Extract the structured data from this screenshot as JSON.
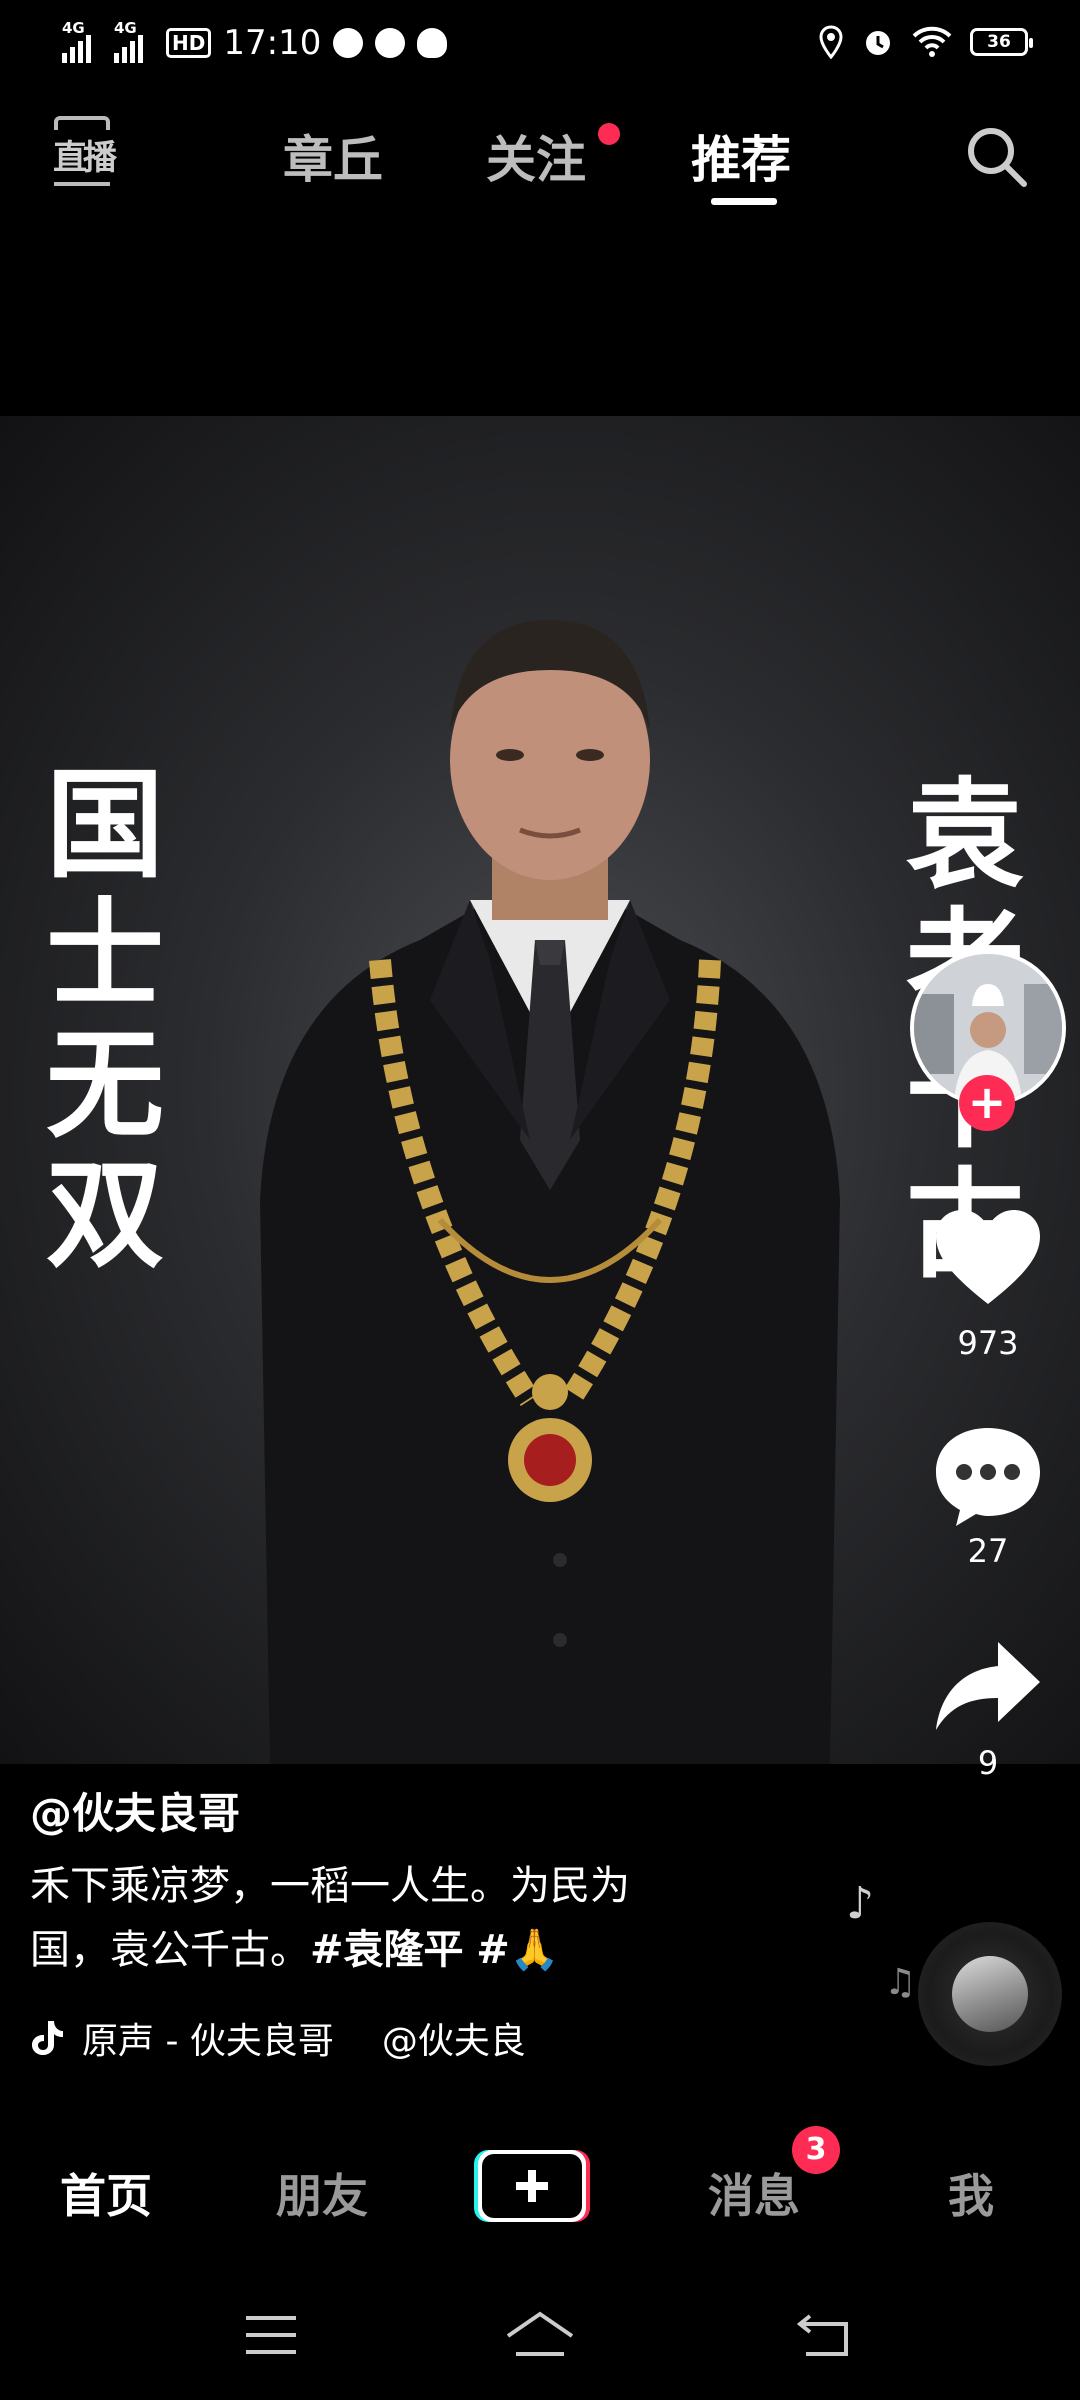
{
  "status_bar": {
    "network_1": "4G",
    "network_2": "4G",
    "hd": "HD",
    "time": "17:10",
    "battery": "36",
    "icons_left": [
      "wechat-icon",
      "compass-icon",
      "qq-icon"
    ],
    "icons_right": [
      "location-icon",
      "alarm-icon",
      "wifi-icon",
      "battery-icon"
    ]
  },
  "top_nav": {
    "live_label": "直播",
    "tabs": [
      {
        "label": "章丘",
        "active": false
      },
      {
        "label": "关注",
        "active": false,
        "has_dot": true
      },
      {
        "label": "推荐",
        "active": true
      }
    ],
    "search_icon": "search-icon"
  },
  "video": {
    "left_text": [
      "国",
      "士",
      "无",
      "双"
    ],
    "right_text": [
      "袁",
      "老",
      "千",
      "古"
    ]
  },
  "rail": {
    "likes": "973",
    "comments": "27",
    "shares": "9",
    "accent": "#fe2c55"
  },
  "caption": {
    "author": "@伙夫良哥",
    "text_line1": "禾下乘凉梦，一稻一人生。为民为",
    "text_line2_plain": "国，袁公千古。",
    "hashtag1": "#袁隆平",
    "hashtag2": "#🙏",
    "music": "原声 - 伙夫良哥",
    "music_extra": "@伙夫良"
  },
  "bottom_nav": {
    "items": [
      "首页",
      "朋友",
      "消息",
      "我"
    ],
    "messages_badge": "3"
  }
}
